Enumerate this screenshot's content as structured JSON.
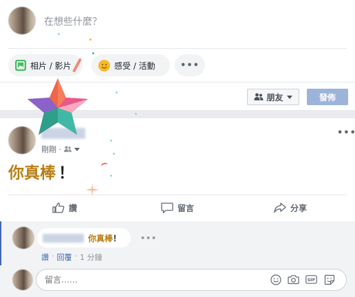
{
  "composer": {
    "placeholder": "在想些什麼？",
    "photo_label": "相片 / 影片",
    "feeling_label": "感受 / 活動",
    "more_label": "•••",
    "audience_label": "朋友",
    "post_label": "發佈"
  },
  "post": {
    "time": "剛剛 ·",
    "more_label": "•••",
    "body_text": "你真棒",
    "body_exclaim": "！",
    "actions": {
      "like": "讚",
      "comment": "留言",
      "share": "分享"
    }
  },
  "comment": {
    "text": "你真棒",
    "exclaim": "！",
    "more_label": "•••",
    "like": "讚",
    "sep1": "·",
    "reply": "回覆",
    "sep2": "·",
    "time": "1 分鐘"
  },
  "reply": {
    "placeholder": "留言……"
  },
  "colors": {
    "accent": "#4267b2",
    "highlight_text": "#b77e14",
    "post_button_disabled": "#9cb4d8"
  }
}
